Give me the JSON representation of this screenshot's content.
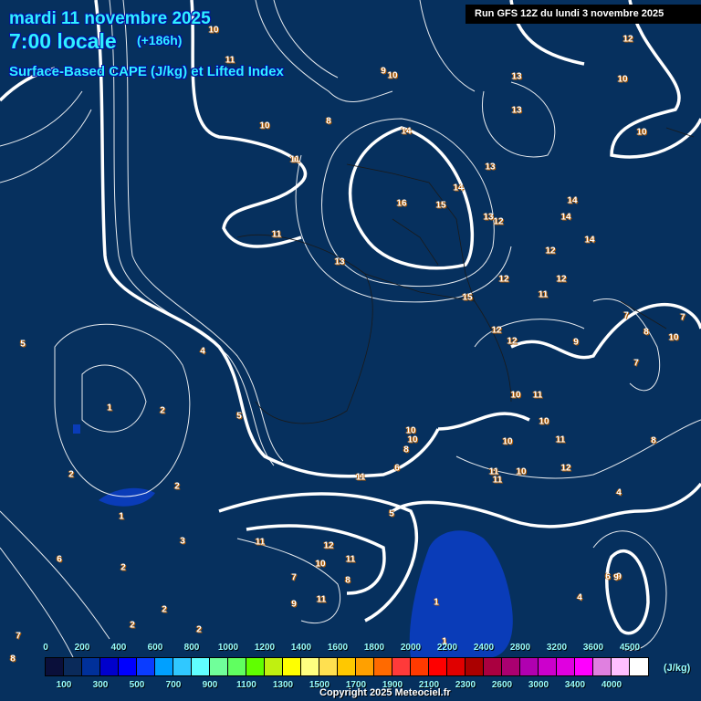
{
  "header": {
    "date": "mardi 11 novembre 2025",
    "time": "7:00 locale",
    "lead": "(+186h)",
    "parameter": "Surface-Based CAPE (J/kg) et Lifted Index",
    "run": "Run GFS 12Z du lundi 3 novembre 2025"
  },
  "legend": {
    "top_labels": [
      "0",
      "200",
      "400",
      "600",
      "800",
      "1000",
      "1200",
      "1400",
      "1600",
      "1800",
      "2000",
      "2200",
      "2400",
      "2800",
      "3200",
      "3600",
      "4500"
    ],
    "bottom_labels": [
      "100",
      "300",
      "500",
      "700",
      "900",
      "1100",
      "1300",
      "1500",
      "1700",
      "1900",
      "2100",
      "2300",
      "2600",
      "3000",
      "3400",
      "4000"
    ],
    "colors": [
      "#0a0f3a",
      "#0a2a5a",
      "#00309a",
      "#0000cc",
      "#0000ff",
      "#0a3cff",
      "#00a0ff",
      "#30c8ff",
      "#60ffff",
      "#70ff9a",
      "#60ff60",
      "#60ff00",
      "#c0f010",
      "#ffff00",
      "#ffff80",
      "#ffe050",
      "#ffc800",
      "#ffa000",
      "#ff6a00",
      "#ff3a3a",
      "#ff3a00",
      "#ff0000",
      "#e00000",
      "#aa0000",
      "#aa0040",
      "#aa0070",
      "#b000b0",
      "#cc00cc",
      "#e000e0",
      "#ff00ff",
      "#e080e0",
      "#ffc0ff",
      "#ffffff"
    ],
    "unit": "(J/kg)"
  },
  "lifted_index_labels": [
    "10",
    "11",
    "12",
    "10",
    "13",
    "13",
    "10",
    "9",
    "10",
    "8",
    "10",
    "11",
    "13",
    "14",
    "16",
    "15",
    "14",
    "13",
    "12",
    "14",
    "14",
    "12",
    "14",
    "12",
    "11",
    "15",
    "13",
    "12",
    "11",
    "12",
    "12",
    "10",
    "11",
    "10",
    "11",
    "12",
    "10",
    "10",
    "11",
    "11",
    "11",
    "10",
    "10",
    "6",
    "8",
    "9",
    "5",
    "11",
    "12",
    "10",
    "11",
    "8",
    "9",
    "11",
    "7",
    "8",
    "7",
    "1",
    "2",
    "2",
    "1",
    "2",
    "2",
    "3",
    "2",
    "2",
    "2",
    "5",
    "4",
    "5",
    "6",
    "8",
    "7",
    "9",
    "10",
    "7",
    "8",
    "7",
    "4",
    "4",
    "6",
    "9",
    "1",
    "1"
  ],
  "copyright": "Copyright 2025 Meteociel.fr"
}
